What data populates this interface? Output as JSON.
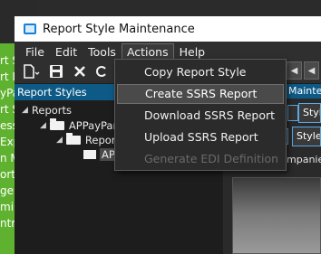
{
  "background_app": {
    "fragments": [
      "rt S",
      "rt D",
      "yPa",
      "rt S",
      "ess",
      "Exp",
      "n M",
      "ort M",
      "ge",
      "mi",
      "ntr"
    ]
  },
  "window": {
    "title": "Report Style Maintenance"
  },
  "menubar": {
    "items": [
      "File",
      "Edit",
      "Tools",
      "Actions",
      "Help"
    ],
    "active": "Actions"
  },
  "toolbar": {
    "icons": [
      "new-icon",
      "save-icon",
      "delete-icon",
      "refresh-icon"
    ]
  },
  "left_panel": {
    "header": "Report Styles",
    "tree": [
      {
        "label": "Reports",
        "level": 0,
        "expanded": true
      },
      {
        "label": "APPayPar",
        "level": 1,
        "expanded": true
      },
      {
        "label": "Report Sty",
        "level": 2,
        "expanded": true
      },
      {
        "label": "AP",
        "level": 3,
        "selected": true
      }
    ]
  },
  "right_panel": {
    "header": "Mainten",
    "tab1": "Style",
    "tab2": "Style",
    "text": "mpanies"
  },
  "actions_menu": {
    "items": [
      {
        "label": "Copy Report Style",
        "state": "normal"
      },
      {
        "label": "Create SSRS Report",
        "state": "hover"
      },
      {
        "label": "Download SSRS Report",
        "state": "normal"
      },
      {
        "label": "Upload SSRS Report",
        "state": "normal"
      },
      {
        "label": "Generate EDI Definition",
        "state": "disabled"
      }
    ]
  }
}
